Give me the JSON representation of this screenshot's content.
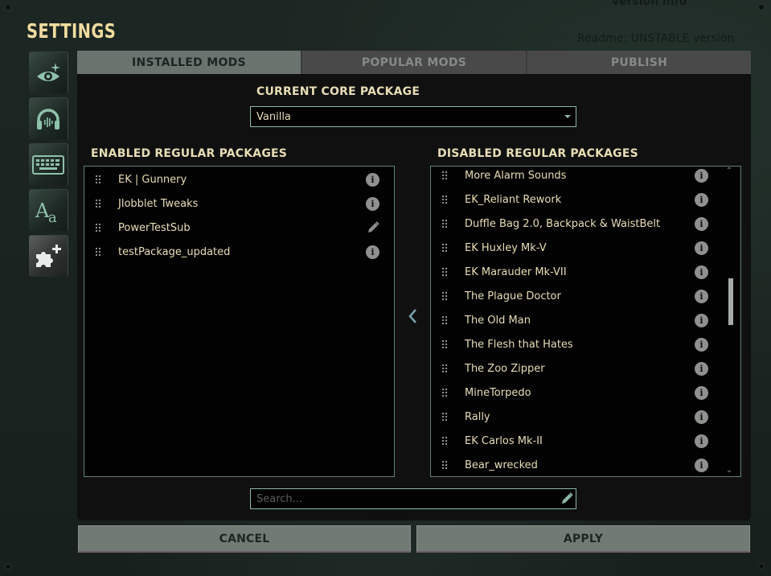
{
  "background": {
    "readme_text": "Readme: UNSTABLE version",
    "top_text": "Version info"
  },
  "title": "SETTINGS",
  "sidenav": [
    {
      "name": "graphics",
      "icon": "eye-sparkle-icon"
    },
    {
      "name": "audio",
      "icon": "headphones-icon"
    },
    {
      "name": "controls",
      "icon": "keyboard-icon"
    },
    {
      "name": "language",
      "icon": "font-aa-icon"
    },
    {
      "name": "mods",
      "icon": "puzzle-plus-icon",
      "active": true
    }
  ],
  "tabs": [
    {
      "label": "INSTALLED MODS",
      "active": true
    },
    {
      "label": "POPULAR MODS",
      "active": false
    },
    {
      "label": "PUBLISH",
      "active": false
    }
  ],
  "core_package": {
    "label": "CURRENT CORE PACKAGE",
    "selected": "Vanilla"
  },
  "enabled": {
    "label": "ENABLED REGULAR PACKAGES",
    "items": [
      {
        "name": "EK | Gunnery",
        "action": "info"
      },
      {
        "name": "Jlobblet Tweaks",
        "action": "info"
      },
      {
        "name": "PowerTestSub",
        "action": "edit"
      },
      {
        "name": "testPackage_updated",
        "action": "info"
      }
    ]
  },
  "disabled": {
    "label": "DISABLED REGULAR PACKAGES",
    "items": [
      {
        "name": "More Alarm Sounds",
        "action": "info"
      },
      {
        "name": "EK_Reliant Rework",
        "action": "info"
      },
      {
        "name": "Duffle Bag 2.0, Backpack & WaistBelt",
        "action": "info"
      },
      {
        "name": "EK Huxley Mk-V",
        "action": "info"
      },
      {
        "name": "EK Marauder Mk-VII",
        "action": "info"
      },
      {
        "name": "The Plague Doctor",
        "action": "info"
      },
      {
        "name": "The Old Man",
        "action": "info"
      },
      {
        "name": "The Flesh that Hates",
        "action": "info"
      },
      {
        "name": "The Zoo Zipper",
        "action": "info"
      },
      {
        "name": "MineTorpedo",
        "action": "info"
      },
      {
        "name": "Rally",
        "action": "info"
      },
      {
        "name": "EK Carlos Mk-II",
        "action": "info"
      },
      {
        "name": "Bear_wrecked",
        "action": "info"
      }
    ],
    "scroll_position_fraction": 0.5
  },
  "search": {
    "placeholder": "Search...",
    "value": ""
  },
  "buttons": {
    "cancel": "CANCEL",
    "apply": "APPLY"
  },
  "colors": {
    "title": "#f0dca0",
    "text": "#e8ddb5",
    "accent_border": "#8fb8a6",
    "tab_active": "#6b736e",
    "tab_inactive": "#484948"
  }
}
